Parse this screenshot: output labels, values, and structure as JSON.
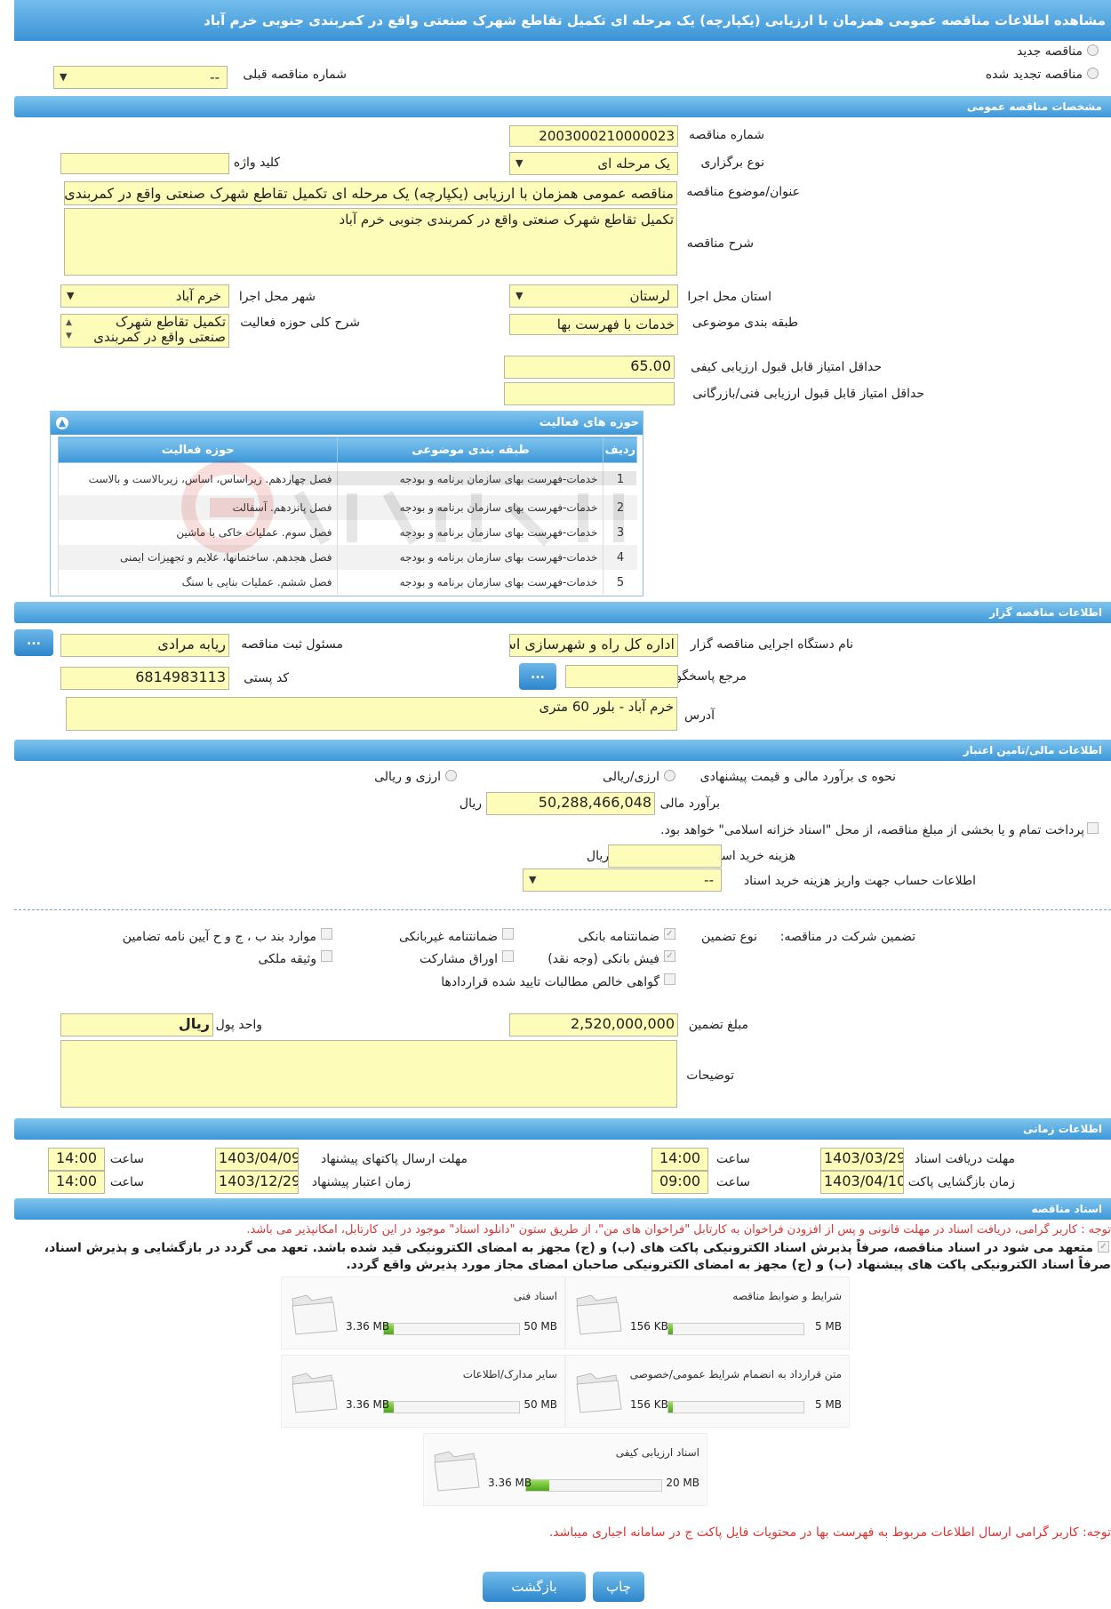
{
  "header": {
    "title": "مشاهده اطلاعات مناقصه عمومی همزمان با ارزیابی (یکپارچه) یک مرحله ای تکمیل تقاطع شهرک صنعتی واقع در کمربندی جنوبی خرم آباد"
  },
  "top": {
    "radio_new": "مناقصه جدید",
    "radio_renew": "مناقصه تجدید شده",
    "prev_label": "شماره مناقصه قبلی",
    "prev_value": "--"
  },
  "general": {
    "section": "مشخصات مناقصه عمومی",
    "number_label": "شماره مناقصه",
    "number_value": "2003000210000023",
    "type_label": "نوع برگزاری",
    "type_value": "یک مرحله ای",
    "keyword_label": "کلید واژه",
    "keyword_value": "",
    "subject_label": "عنوان/موضوع مناقصه",
    "subject_value": "مناقصه عمومی همزمان با ارزیابی (یکپارچه) یک مرحله ای تکمیل تقاطع شهرک صنعتی واقع در کمربندی جنوبی خرم آباد",
    "desc_label": "شرح مناقصه",
    "desc_value": "تکمیل تقاطع شهرک صنعتی واقع در کمربندی جنوبی خرم آباد",
    "province_label": "استان محل اجرا",
    "province_value": "لرستان",
    "city_label": "شهر محل اجرا",
    "city_value": "خرم آباد",
    "category_label": "طبقه بندی موضوعی",
    "category_value": "خدمات با فهرست بها",
    "activity_label": "شرح کلی حوزه فعالیت",
    "activity_value": "تکمیل تقاطع شهرک صنعتی واقع در کمربندی",
    "minq_label": "حداقل امتیاز قابل قبول ارزیابی کیفی",
    "minq_value": "65.00",
    "mint_label": "حداقل امتیاز قابل قبول ارزیابی فنی/بازرگانی",
    "mint_value": ""
  },
  "activities": {
    "title": "حوزه های فعالیت",
    "headers": [
      "ردیف",
      "طبقه بندی موضوعی",
      "حوزه فعالیت"
    ],
    "rows": [
      [
        "1",
        "خدمات-فهرست بهای سازمان برنامه و بودجه",
        "فصل چهاردهم. زیراساس، اساس، زیربالاست  و بالاست"
      ],
      [
        "2",
        "خدمات-فهرست بهای سازمان برنامه و بودجه",
        "فصل پانزدهم. آسفالت"
      ],
      [
        "3",
        "خدمات-فهرست بهای سازمان برنامه و بودجه",
        "فصل سوم. عملیات خاکی با ماشین"
      ],
      [
        "4",
        "خدمات-فهرست بهای سازمان برنامه و بودجه",
        "فصل هجدهم. ساختمانها، علایم و تجهیزات ایمنی"
      ],
      [
        "5",
        "خدمات-فهرست بهای سازمان برنامه و بودجه",
        "فصل ششم. عملیات بنایی با سنگ"
      ]
    ]
  },
  "organizer": {
    "section": "اطلاعات مناقصه گزار",
    "org_label": "نام دستگاه اجرایی مناقصه گزار",
    "org_value": "اداره کل راه و شهرسازی استان لرستان",
    "resp_label": "مسئول ثبت مناقصه",
    "resp_value": "ریابه مرادی",
    "ref_label": "مرجع پاسخگویی",
    "ref_value": "",
    "postal_label": "کد پستی",
    "postal_value": "6814983113",
    "address_label": "آدرس",
    "address_value": "خرم آباد - بلور 60 متری",
    "dots": "..."
  },
  "finance": {
    "section": "اطلاعات مالی/تامین اعتبار",
    "method_label": "نحوه ی برآورد مالی و قیمت پیشنهادی",
    "opt_rial": "ارزی/ریالی",
    "opt_both": "ارزی و ریالی",
    "estimate_label": "برآورد مالی",
    "estimate_value": "50,288,466,048",
    "estimate_unit": "ریال",
    "treasury_text": "پرداخت تمام و یا بخشی از مبلغ مناقصه، از محل \"اسناد خزانه اسلامی\" خواهد بود.",
    "docfee_label": "هزینه خرید اسناد",
    "docfee_value": "",
    "docfee_unit": "ریال",
    "account_label": "اطلاعات حساب جهت واریز هزینه خرید اسناد",
    "account_value": "--"
  },
  "guarantee": {
    "label": "تضمین شرکت در مناقصه:",
    "type_label": "نوع تضمین",
    "options": {
      "bank": "ضمانتنامه بانکی",
      "nonbank": "ضمانتنامه غیربانکی",
      "articles": "موارد بند ب ، ج و ح آیین نامه تضامین",
      "cheque": "فیش بانکی (وجه نقد)",
      "bonds": "اوراق مشارکت",
      "property": "وثیقه ملکی",
      "receivables": "گواهی خالص مطالبات تایید شده قراردادها"
    },
    "amount_label": "مبلغ تضمین",
    "amount_value": "2,520,000,000",
    "currency_label": "واحد پول",
    "currency_value": "ریال",
    "notes_label": "توضیحات",
    "notes_value": ""
  },
  "timing": {
    "section": "اطلاعات زمانی",
    "doc_deadline_label": "مهلت دریافت اسناد",
    "doc_deadline_date": "1403/03/29",
    "doc_deadline_time": "14:00",
    "submit_label": "مهلت ارسال پاکتهای پیشنهاد",
    "submit_date": "1403/04/09",
    "submit_time": "14:00",
    "open_label": "زمان بازگشایی پاکت ها",
    "open_date": "1403/04/10",
    "open_time": "09:00",
    "validity_label": "زمان اعتبار پیشنهاد",
    "validity_date": "1403/12/29",
    "validity_time": "14:00",
    "time_label": "ساعت"
  },
  "documents": {
    "section": "اسناد مناقصه",
    "notice": "توجه : کاربر گرامی، دریافت اسناد در مهلت قانونی و پس از افزودن فراخوان به کارتابل \"فراخوان های من\"، از طریق ستون \"دانلود اسناد\" موجود در این کارتابل، امکانپذیر می باشد.",
    "commit1": "متعهد می شود در اسناد مناقصه، صرفاً پذیرش اسناد الکترونیکی پاکت های (ب) و (ج) مجهز به امضای الکترونیکی قید شده باشد. تعهد می گردد در بازگشایی و پذیرش اسناد،",
    "commit2": "صرفاً اسناد الکترونیکی پاکت های پیشنهاد (ب) و (ج) مجهز به امضای الکترونیکی صاحبان امضای مجاز مورد پذیرش واقع گردد.",
    "files": [
      {
        "title": "شرایط و ضوابط مناقصه",
        "max": "5 MB",
        "size": "156 KB",
        "fill": 0.03
      },
      {
        "title": "اسناد فنی",
        "max": "50 MB",
        "size": "3.36 MB",
        "fill": 0.07
      },
      {
        "title": "متن قرارداد به انضمام شرایط عمومی/خصوصی",
        "max": "5 MB",
        "size": "156 KB",
        "fill": 0.03
      },
      {
        "title": "سایر مدارک/اطلاعات",
        "max": "50 MB",
        "size": "3.36 MB",
        "fill": 0.07
      },
      {
        "title": "اسناد ارزیابی کیفی",
        "max": "20 MB",
        "size": "3.36 MB",
        "fill": 0.17
      }
    ],
    "bottom_notice": "توجه: کاربر گرامی ارسال اطلاعات مربوط به فهرست بها در محتویات فایل پاکت ج در سامانه اجباری میباشد."
  },
  "buttons": {
    "print": "چاپ",
    "back": "بازگشت"
  },
  "colors": {
    "accent": "#3d97d8",
    "field": "#fdfcb8",
    "warning": "#d33333"
  }
}
